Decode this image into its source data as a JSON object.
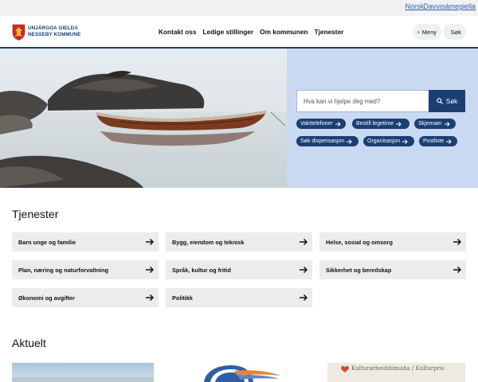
{
  "languages": [
    "Norsk",
    "Davvisámegiella"
  ],
  "logo": {
    "line1": "UNJÁRGGA GIELDA",
    "line2": "NESSEBY KOMMUNE",
    "icon": "coat-of-arms-icon"
  },
  "nav": [
    "Kontakt oss",
    "Ledige stillinger",
    "Om kommunen",
    "Tjenester"
  ],
  "header_buttons": {
    "menu": "Meny",
    "search": "Søk"
  },
  "search": {
    "placeholder": "Hva kan vi hjelpe deg med?",
    "button": "Søk"
  },
  "quick_links": [
    "Vakttelefoner",
    "Bestill legetime",
    "Skjemaer",
    "Søk dispensasjon",
    "Organisasjon",
    "Postliste"
  ],
  "services": {
    "title": "Tjenester",
    "items": [
      "Barn unge og familie",
      "Bygg, eiendom og teknisk",
      "Helse, sosial og omsorg",
      "Plan, næring og naturforvaltning",
      "Språk, kultur og fritid",
      "Sikkerhet og beredskap",
      "Økonomi og avgifter",
      "Politikk"
    ]
  },
  "news": {
    "title": "Aktuelt",
    "third_card_text": "Kulturarbeiddiimaha / Kulturpris"
  },
  "colors": {
    "navy": "#1b3f73",
    "panel": "#c9d9f2",
    "tile": "#ececec",
    "link": "#2f5fa8"
  }
}
